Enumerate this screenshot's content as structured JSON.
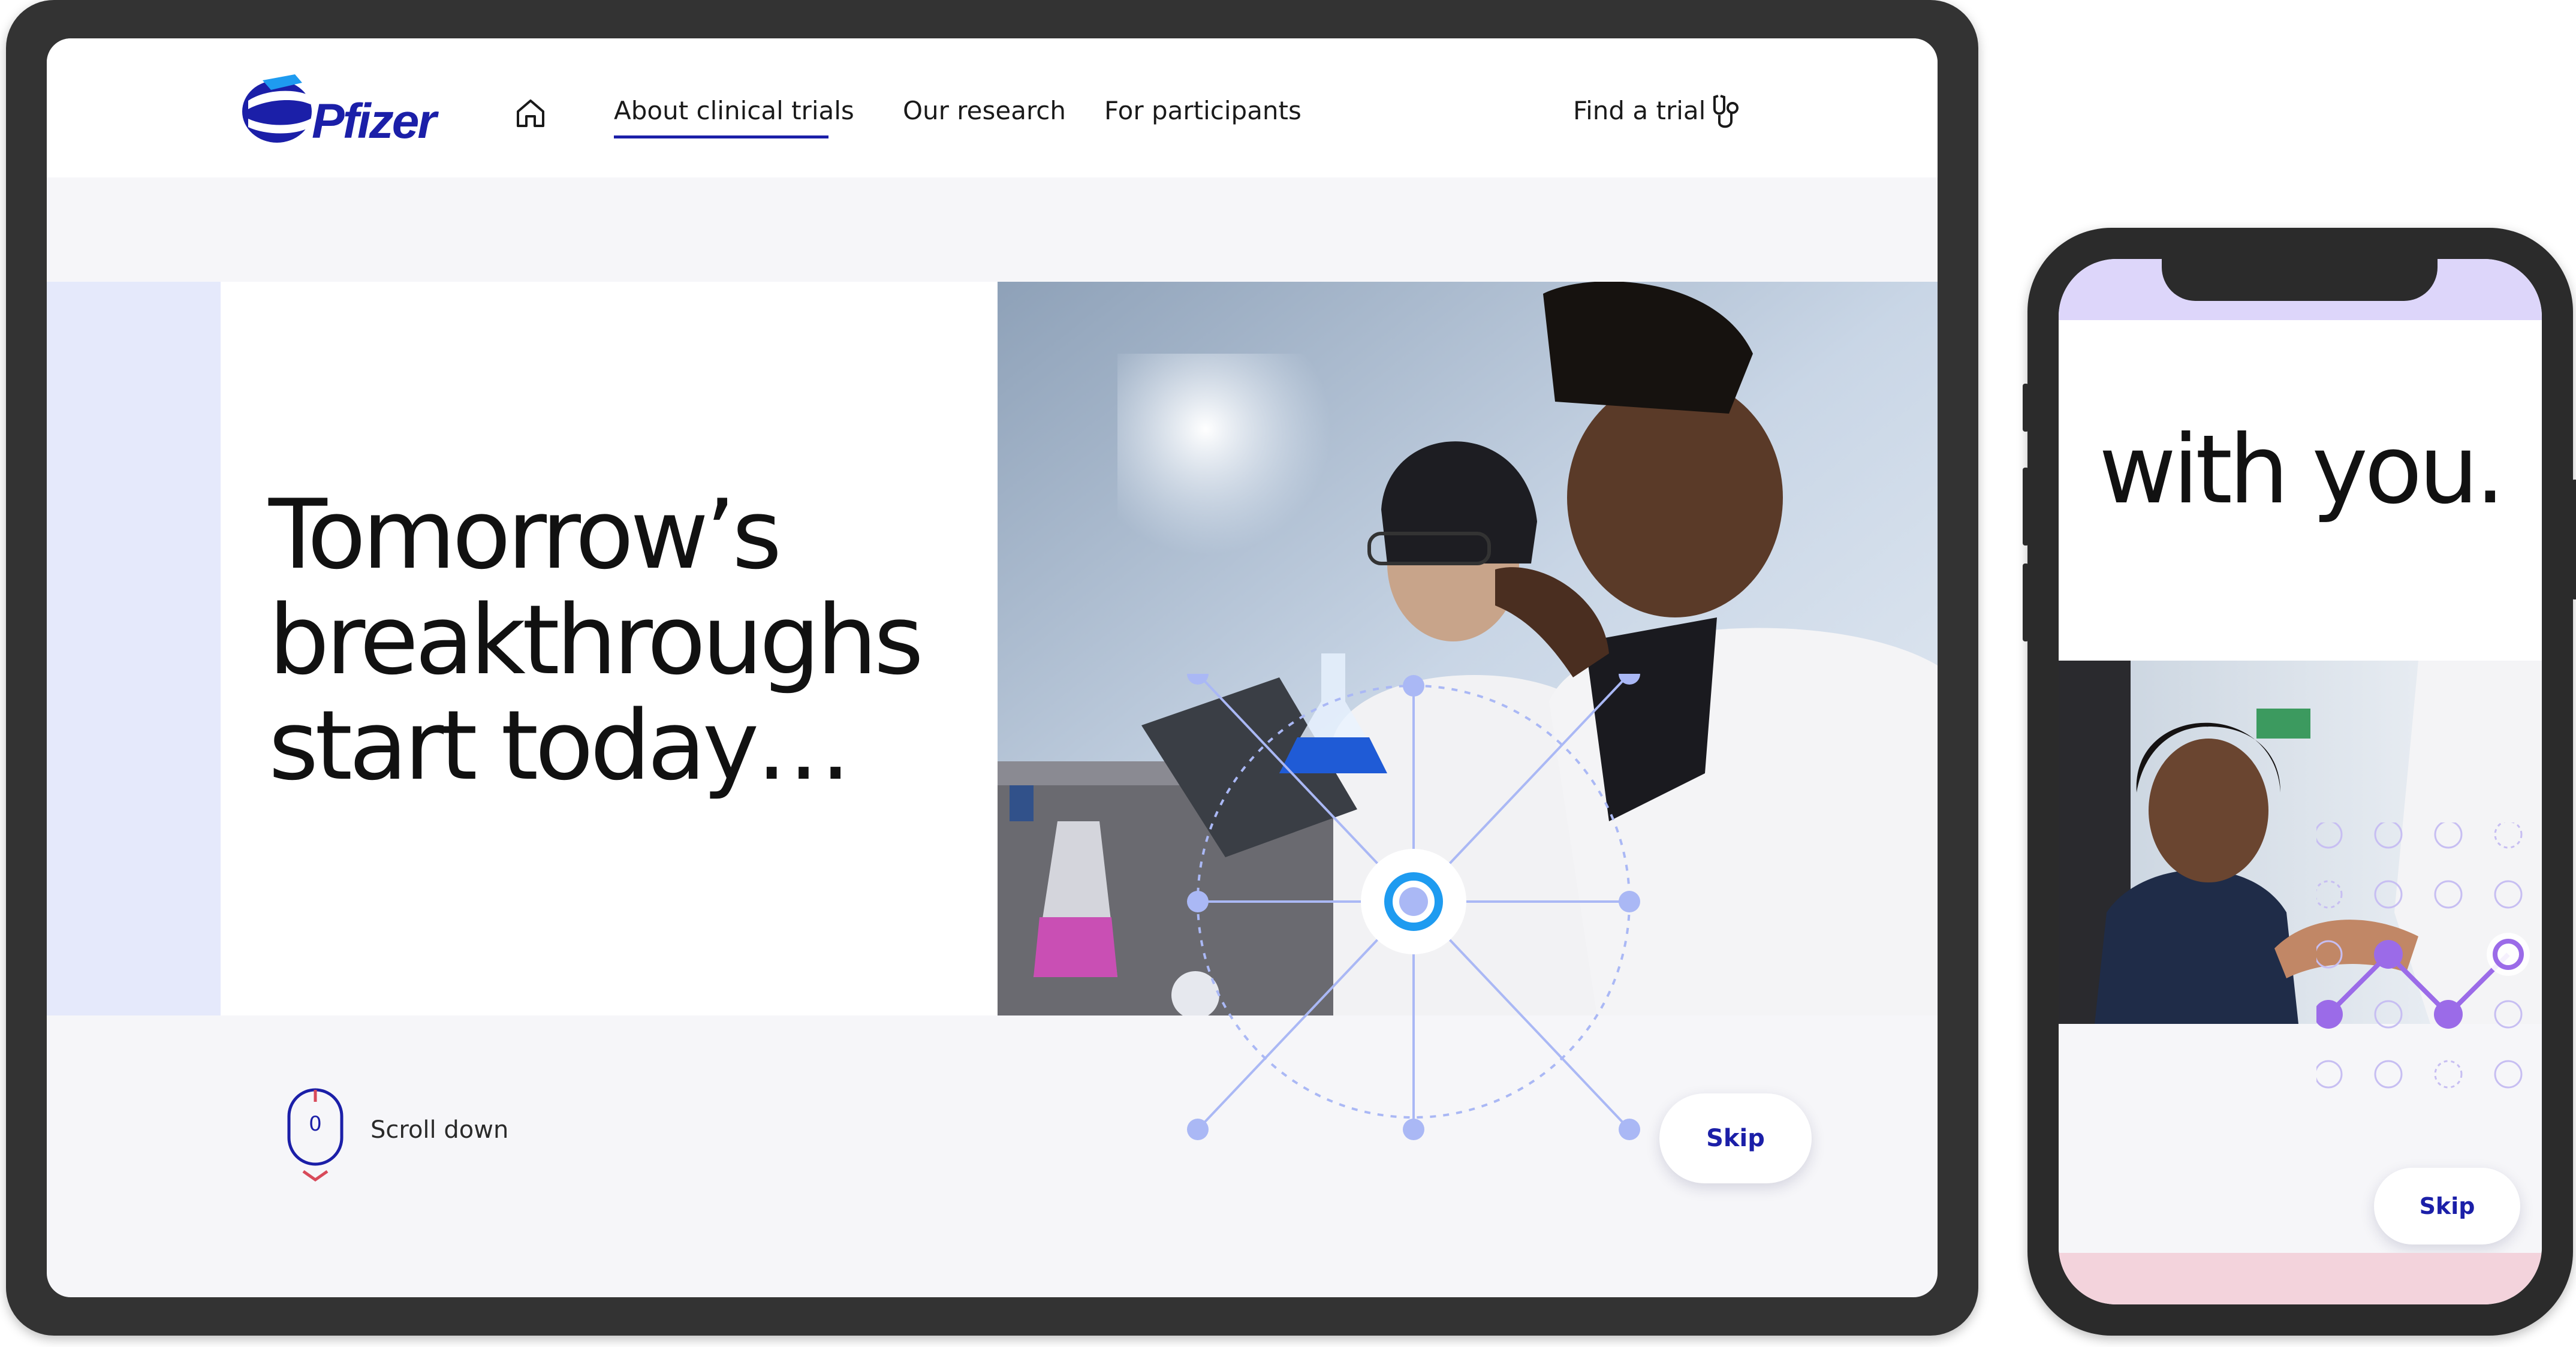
{
  "brand": {
    "logo_text": "Pfizer",
    "color": "#1b1fa8"
  },
  "nav": {
    "home": "home-icon",
    "items": [
      {
        "label": "About clinical trials",
        "active": true
      },
      {
        "label": "Our research",
        "active": false
      },
      {
        "label": "For participants",
        "active": false
      }
    ],
    "find_trial": "Find a trial"
  },
  "hero": {
    "title_lines": [
      "Tomorrow’s",
      "breakthroughs",
      "start today…"
    ]
  },
  "scroll": {
    "label": "Scroll down"
  },
  "skip": {
    "label": "Skip"
  },
  "phone": {
    "headline": "with you.",
    "skip_label": "Skip",
    "colors": {
      "top_band": "#ddd6fa",
      "bottom_band": "#f3d3dc",
      "accent": "#9b6be8"
    }
  },
  "colors": {
    "accent_blue": "#1b1fa8",
    "hero_side_bar": "#e5e9fb",
    "network_node": "#aab8f5",
    "network_center": "#1e9bf0"
  }
}
